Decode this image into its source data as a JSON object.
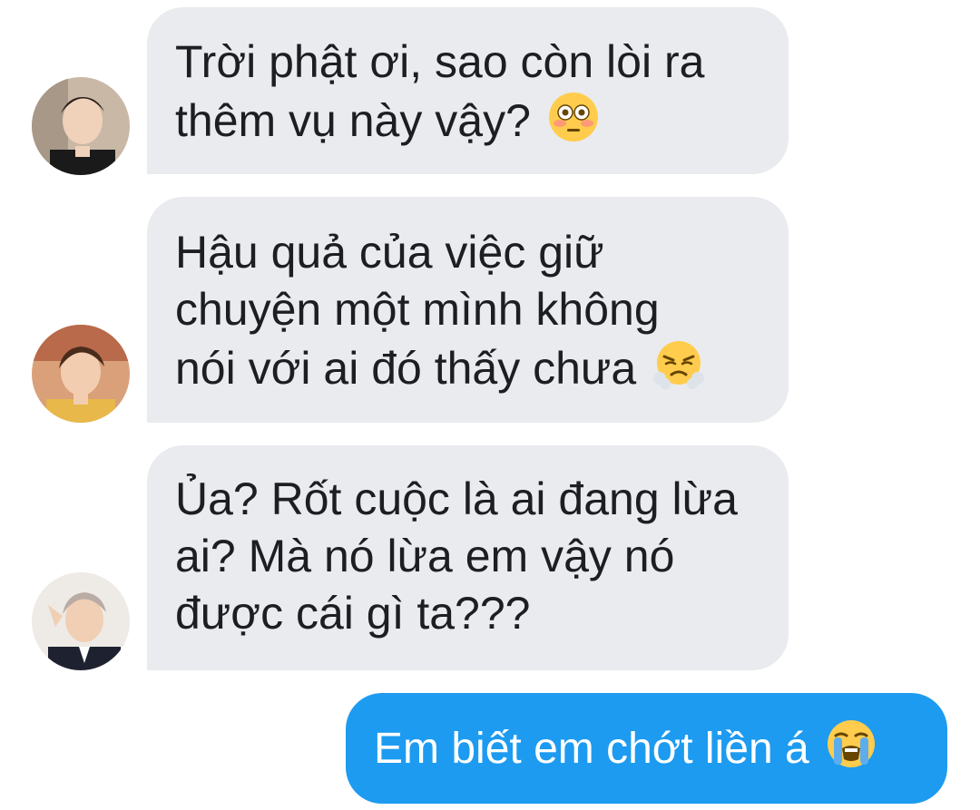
{
  "messages": [
    {
      "lines": [
        "Trời phật ơi, sao còn lòi ra",
        "thêm vụ này vậy?"
      ],
      "emoji": "flushed-face-icon"
    },
    {
      "lines": [
        "Hậu quả của việc giữ",
        "chuyện một mình không",
        "nói với ai đó thấy chưa"
      ],
      "emoji": "face-with-steam-icon"
    },
    {
      "lines": [
        "Ủa? Rốt cuộc là ai đang lừa",
        "ai? Mà nó lừa em vậy nó",
        "được cái gì ta???"
      ],
      "emoji": ""
    }
  ],
  "outgoing": {
    "text": "Em biết em chớt liền á",
    "emoji": "loudly-crying-face-icon"
  },
  "colors": {
    "incoming_bubble": "#e9ebee",
    "outgoing_bubble": "#1d9bf0",
    "text_dark": "#1c1e21",
    "text_light": "#ffffff"
  }
}
